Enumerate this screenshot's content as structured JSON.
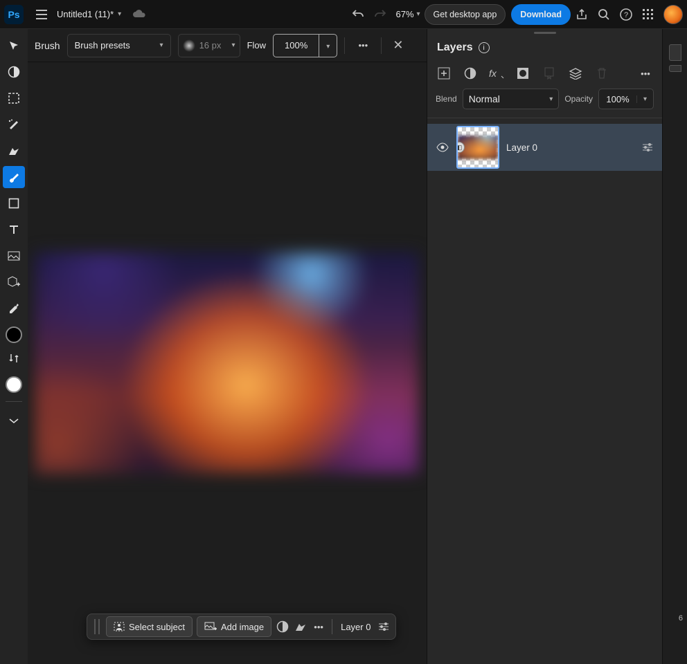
{
  "header": {
    "doc_title": "Untitled1 (11)*",
    "zoom": "67%",
    "cta_desktop": "Get desktop app",
    "cta_download": "Download"
  },
  "optionbar": {
    "tool_label": "Brush",
    "presets_label": "Brush presets",
    "size_value": "16 px",
    "flow_label": "Flow",
    "flow_value": "100%"
  },
  "contextbar": {
    "select_subject": "Select subject",
    "add_image": "Add image",
    "layer_label": "Layer 0"
  },
  "layers_panel": {
    "title": "Layers",
    "blend_label": "Blend",
    "blend_value": "Normal",
    "opacity_label": "Opacity",
    "opacity_value": "100%",
    "layers": [
      {
        "name": "Layer 0",
        "visible": true
      }
    ]
  },
  "right_strip": {
    "counter": "6"
  }
}
